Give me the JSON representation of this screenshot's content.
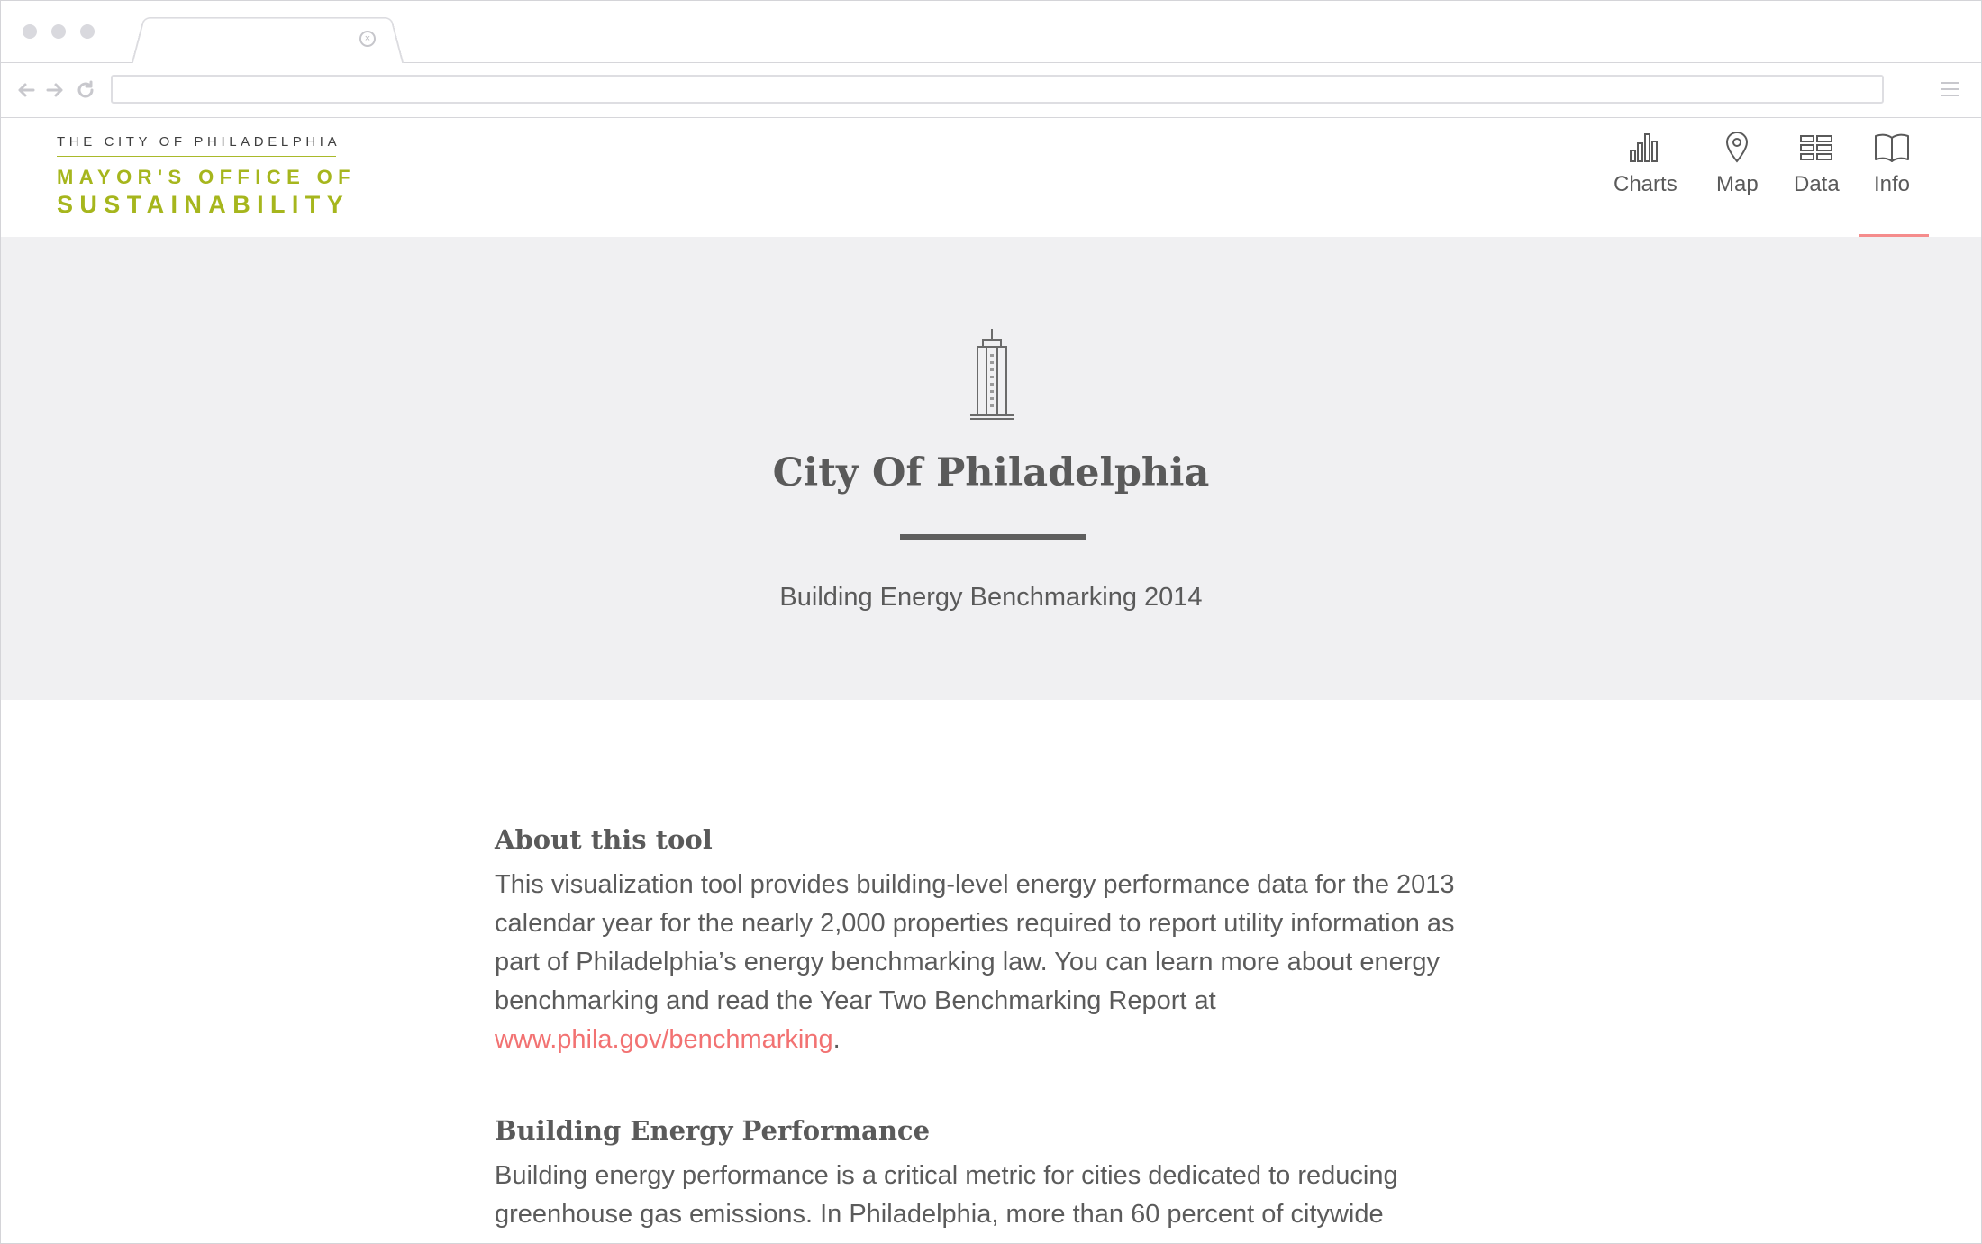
{
  "browser": {
    "url": "",
    "tab_close": "×"
  },
  "logo": {
    "line1": "THE CITY OF PHILADELPHIA",
    "line2": "MAYOR'S OFFICE OF",
    "line3": "SUSTAINABILITY"
  },
  "nav": {
    "items": [
      {
        "label": "Charts",
        "icon": "bar-chart-icon"
      },
      {
        "label": "Map",
        "icon": "map-pin-icon"
      },
      {
        "label": "Data",
        "icon": "table-icon"
      },
      {
        "label": "Info",
        "icon": "book-icon"
      }
    ],
    "active": "Info"
  },
  "colors": {
    "accent": "#f58c8c",
    "link": "#f27272",
    "brand_green": "#a6b61d",
    "hero_bg": "#f0f0f2",
    "text": "#5b5b5b"
  },
  "hero": {
    "icon": "skyscraper-icon",
    "title": "City Of Philadelphia",
    "subtitle": "Building Energy Benchmarking 2014"
  },
  "about": {
    "heading": "About this tool",
    "text": "This visualization tool provides building-level energy performance data for the 2013 calendar year for the nearly 2,000 properties required to report utility information as part of Philadelphia’s energy benchmarking law. You can learn more about energy benchmarking and read the Year Two Benchmarking Report at ",
    "link": "www.phila.gov/benchmarking",
    "after": "."
  },
  "performance": {
    "heading": "Building Energy Performance",
    "text": "Building energy performance is a critical metric for cities dedicated to reducing greenhouse gas emissions. In Philadelphia, more than 60 percent of citywide"
  }
}
